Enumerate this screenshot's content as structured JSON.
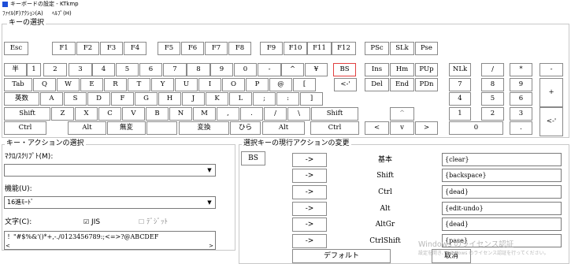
{
  "window": {
    "title": "キーボードの設定 - KTkmp"
  },
  "menu": [
    "ﾌｧｲﾙ(F)",
    "ｱｸｼｮﾝ(A)",
    "ﾍﾙﾌﾟ(H)"
  ],
  "key_section": {
    "legend": "キーの選択"
  },
  "keys": {
    "r1": [
      "Esc",
      "F1",
      "F2",
      "F3",
      "F4",
      "F5",
      "F6",
      "F7",
      "F8",
      "F9",
      "F10",
      "F11",
      "F12",
      "PSc",
      "SLk",
      "Pse"
    ],
    "r2": [
      "半",
      "1",
      "2",
      "3",
      "4",
      "5",
      "6",
      "7",
      "8",
      "9",
      "0",
      "-",
      "^",
      "¥",
      "BS",
      "Ins",
      "Hm",
      "PUp",
      "NLk",
      "/",
      "*",
      "-"
    ],
    "r3": [
      "Tab",
      "Q",
      "W",
      "E",
      "R",
      "T",
      "Y",
      "U",
      "I",
      "O",
      "P",
      "@",
      "[",
      "<-'",
      "Del",
      "End",
      "PDn",
      "7",
      "8",
      "9",
      "+"
    ],
    "r4": [
      "英数",
      "A",
      "S",
      "D",
      "F",
      "G",
      "H",
      "J",
      "K",
      "L",
      ";",
      ":",
      "]",
      "4",
      "5",
      "6"
    ],
    "r5": [
      "Shift",
      "Z",
      "X",
      "C",
      "V",
      "B",
      "N",
      "M",
      ",",
      ".",
      "/",
      "\\",
      "Shift",
      "^",
      "1",
      "2",
      "3",
      "<-'"
    ],
    "r6": [
      "Ctrl",
      "Alt",
      "無変",
      "",
      "変換",
      "ひら",
      "Alt",
      "Ctrl",
      "<",
      "v",
      ">",
      "0",
      "."
    ]
  },
  "action_section": {
    "legend": "キー・アクションの選択",
    "macro_label": "ﾏｸﾛ/ｽｸﾘﾌﾟﾄ(M):",
    "macro_value": "",
    "function_label": "機能(U):",
    "function_value": "16進ﾓｰﾄﾞ",
    "char_label": "文字(C):",
    "jis_label": "JIS",
    "jis_checked": true,
    "digit_label": "ﾃﾞｼﾞｯﾄ",
    "digit_checked": false,
    "chars": "！\"#$%&'()*+,-./0123456789:;<=>?@ABCDEF"
  },
  "change_section": {
    "legend": "選択キーの現行アクションの変更",
    "selected_key": "BS",
    "arrow_label": "->",
    "rows": [
      {
        "mod": "基本",
        "value": "{clear}"
      },
      {
        "mod": "Shift",
        "value": "{backspace}"
      },
      {
        "mod": "Ctrl",
        "value": "{dead}"
      },
      {
        "mod": "Alt",
        "value": "{edit-undo}"
      },
      {
        "mod": "AltGr",
        "value": "{dead}"
      },
      {
        "mod": "CtrlShift",
        "value": "{pase}"
      }
    ],
    "default_button": "デフォルト",
    "cancel_button": "取消"
  },
  "watermark": {
    "line1": "Windows のライセンス認証",
    "line2": "設定を開き、Windows のライセンス認証を行ってください。"
  },
  "colors": {
    "selected_key_border": "#e04040",
    "group_border": "#c8c8c8"
  }
}
